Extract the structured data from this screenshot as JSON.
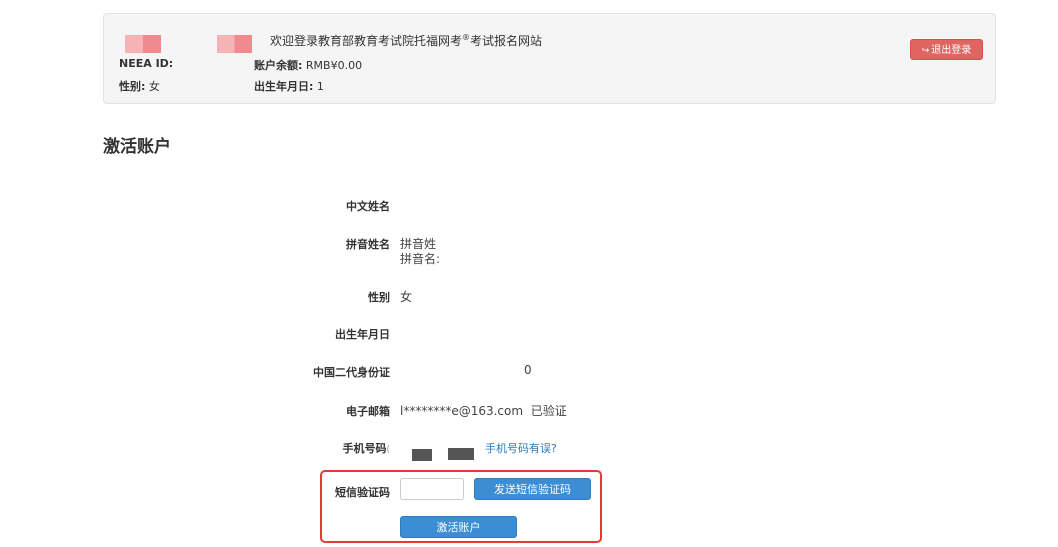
{
  "banner": {
    "neea_id_label": "NEEA ID:",
    "gender_label": "性别:",
    "gender_value": "女",
    "welcome": "欢迎登录教育部教育考试院托福网考",
    "welcome_mark": "®",
    "welcome_suffix": "考试报名网站",
    "balance_label": "账户余额:",
    "balance_value": "RMB¥0.00",
    "dob_label": "出生年月日:",
    "dob_value": "1",
    "logout_icon": "↪",
    "logout_label": "退出登录"
  },
  "page": {
    "title": "激活账户"
  },
  "form": {
    "chinese_name_label": "中文姓名",
    "pinyin_label": "拼音姓名",
    "pinyin_surname": "拼音姓",
    "pinyin_given": "拼音名:",
    "gender_label": "性别",
    "gender_value": "女",
    "dob_label": "出生年月日",
    "id_label": "中国二代身份证",
    "id_value": "0",
    "email_label": "电子邮箱",
    "email_value": "l********e@163.com",
    "email_status": "已验证",
    "phone_label": "手机号码",
    "phone_prefix": "(",
    "phone_error_link": "手机号码有误?",
    "sms_label": "短信验证码",
    "sms_input_value": "",
    "send_sms_button": "发送短信验证码",
    "activate_button": "激活账户"
  },
  "colors": {
    "primary_button": "#3b8dd4",
    "logout_button": "#e06460",
    "link": "#2a7bbf",
    "highlight": "#e53a35"
  }
}
